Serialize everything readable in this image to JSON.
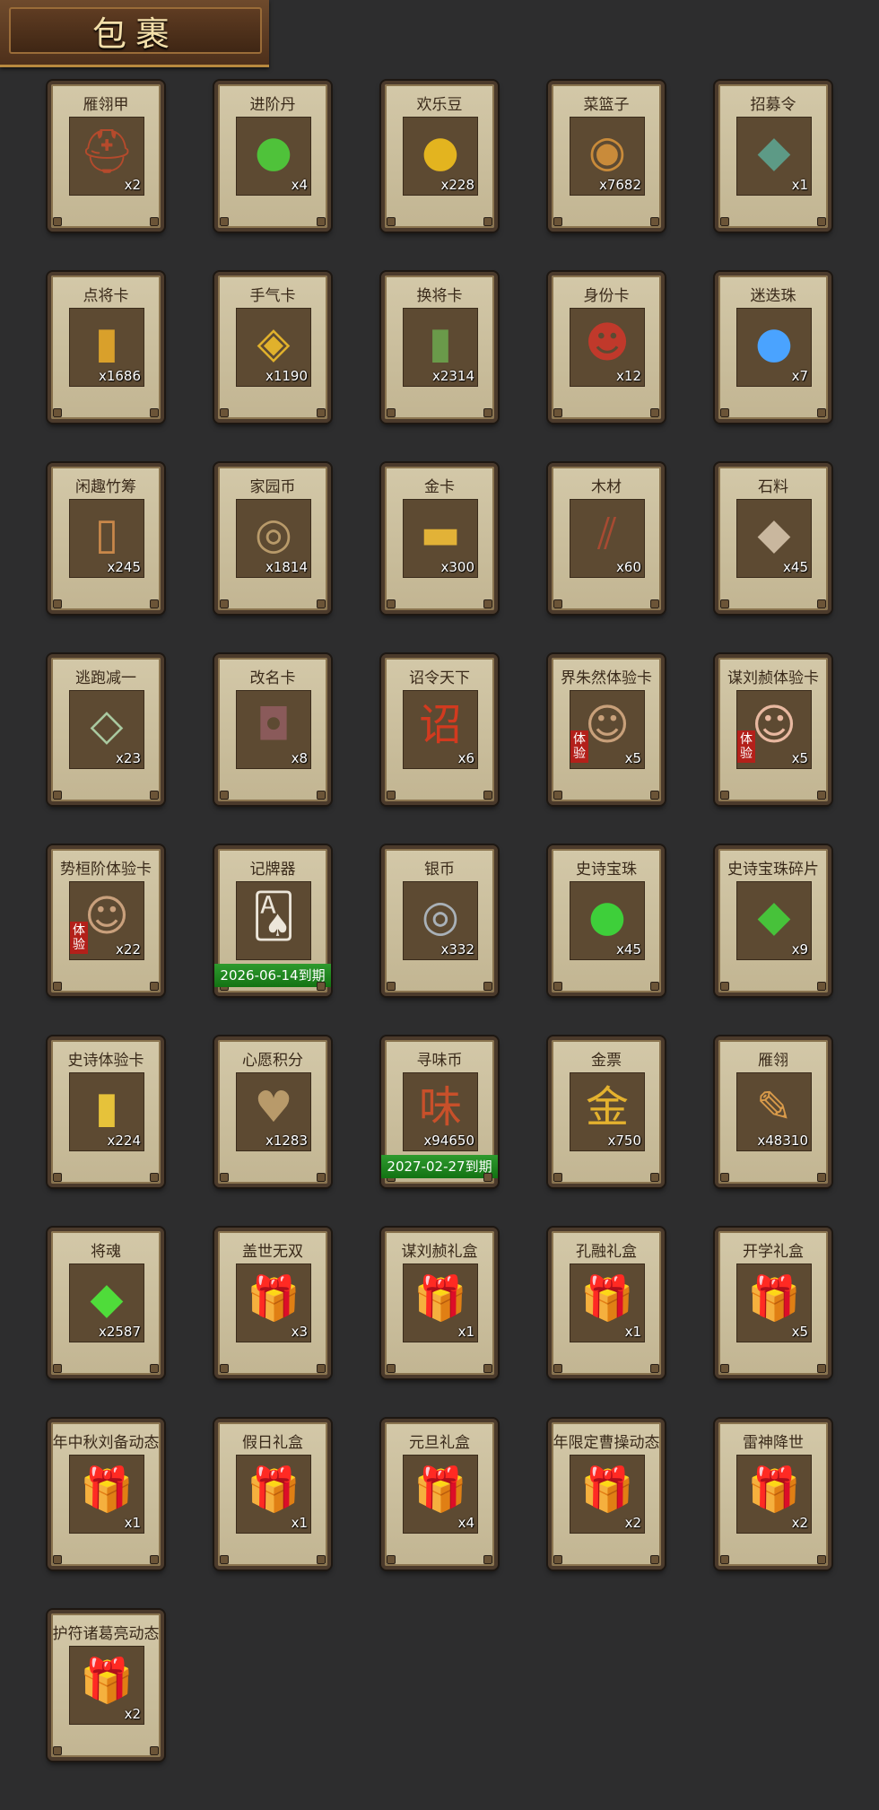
{
  "header": {
    "title": "包裹"
  },
  "items": [
    {
      "name": "雁翎甲",
      "count": "x2",
      "icon": "helmet-icon",
      "glyph": "⛑",
      "color": "#b54a2c"
    },
    {
      "name": "进阶丹",
      "count": "x4",
      "icon": "green-pill-icon",
      "glyph": "●",
      "color": "#4fc23a"
    },
    {
      "name": "欢乐豆",
      "count": "x228",
      "icon": "gold-beans-icon",
      "glyph": "●",
      "color": "#e3b41f"
    },
    {
      "name": "菜篮子",
      "count": "x7682",
      "icon": "basket-icon",
      "glyph": "◉",
      "color": "#c98b3a"
    },
    {
      "name": "招募令",
      "count": "x1",
      "icon": "recruit-token-icon",
      "glyph": "◆",
      "color": "#5d9a86"
    },
    {
      "name": "点将卡",
      "count": "x1686",
      "icon": "general-card-icon",
      "glyph": "▮",
      "color": "#d9a02b"
    },
    {
      "name": "手气卡",
      "count": "x1190",
      "icon": "luck-card-icon",
      "glyph": "◈",
      "color": "#e0b12c"
    },
    {
      "name": "换将卡",
      "count": "x2314",
      "icon": "swap-card-icon",
      "glyph": "▮",
      "color": "#6a9a4a"
    },
    {
      "name": "身份卡",
      "count": "x12",
      "icon": "identity-card-icon",
      "glyph": "☻",
      "color": "#c0392b"
    },
    {
      "name": "迷迭珠",
      "count": "x7",
      "icon": "blue-orb-icon",
      "glyph": "●",
      "color": "#4aa3ff"
    },
    {
      "name": "闲趣竹筹",
      "count": "x245",
      "icon": "bamboo-tally-icon",
      "glyph": "▯",
      "color": "#c9884a"
    },
    {
      "name": "家园币",
      "count": "x1814",
      "icon": "home-coin-icon",
      "glyph": "◎",
      "color": "#b89a6a"
    },
    {
      "name": "金卡",
      "count": "x300",
      "icon": "gold-card-icon",
      "glyph": "▬",
      "color": "#e2b237"
    },
    {
      "name": "木材",
      "count": "x60",
      "icon": "wood-icon",
      "glyph": "⫽",
      "color": "#a84a32"
    },
    {
      "name": "石料",
      "count": "x45",
      "icon": "stone-icon",
      "glyph": "◆",
      "color": "#c9b79e"
    },
    {
      "name": "逃跑减一",
      "count": "x23",
      "icon": "jade-token-icon",
      "glyph": "◇",
      "color": "#a9c9a0"
    },
    {
      "name": "改名卡",
      "count": "x8",
      "icon": "rename-tag-icon",
      "glyph": "◘",
      "color": "#8a5a5a"
    },
    {
      "name": "诏令天下",
      "count": "x6",
      "icon": "decree-scroll-icon",
      "glyph": "诏",
      "color": "#d23a1f"
    },
    {
      "name": "界朱然体验卡",
      "count": "x5",
      "icon": "portrait-zhuran-icon",
      "glyph": "☺",
      "color": "#c8a07a",
      "trial": "体验"
    },
    {
      "name": "谋刘赪体验卡",
      "count": "x5",
      "icon": "portrait-liucheng-icon",
      "glyph": "☺",
      "color": "#e8b8a0",
      "trial": "体验"
    },
    {
      "name": "势桓阶体验卡",
      "count": "x22",
      "icon": "portrait-huanjie-icon",
      "glyph": "☺",
      "color": "#c9a07c",
      "trial": "体验"
    },
    {
      "name": "记牌器",
      "count": "",
      "icon": "playing-cards-icon",
      "glyph": "🂡",
      "color": "#ece6da",
      "expiry": "2026-06-14到期"
    },
    {
      "name": "银币",
      "count": "x332",
      "icon": "silver-coin-icon",
      "glyph": "◎",
      "color": "#a9b1b8"
    },
    {
      "name": "史诗宝珠",
      "count": "x45",
      "icon": "epic-orb-icon",
      "glyph": "●",
      "color": "#3ecf3a"
    },
    {
      "name": "史诗宝珠碎片",
      "count": "x9",
      "icon": "orb-fragment-icon",
      "glyph": "◆",
      "color": "#47c23a"
    },
    {
      "name": "史诗体验卡",
      "count": "x224",
      "icon": "epic-trial-card-icon",
      "glyph": "▮",
      "color": "#e6c23a"
    },
    {
      "name": "心愿积分",
      "count": "x1283",
      "icon": "wish-coin-icon",
      "glyph": "♥",
      "color": "#b89a6a"
    },
    {
      "name": "寻味币",
      "count": "x94650",
      "icon": "flavor-coin-icon",
      "glyph": "味",
      "color": "#c8502a",
      "expiry": "2027-02-27到期"
    },
    {
      "name": "金票",
      "count": "x750",
      "icon": "gold-ticket-icon",
      "glyph": "金",
      "color": "#e4b22e"
    },
    {
      "name": "雁翎",
      "count": "x48310",
      "icon": "feather-icon",
      "glyph": "✎",
      "color": "#d89a4a"
    },
    {
      "name": "将魂",
      "count": "x2587",
      "icon": "general-soul-icon",
      "glyph": "◆",
      "color": "#4fdc3a"
    },
    {
      "name": "盖世无双",
      "count": "x3",
      "icon": "red-gift-box-icon",
      "glyph": "🎁",
      "color": "#c63a2a"
    },
    {
      "name": "谋刘赪礼盒",
      "count": "x1",
      "icon": "blue-gift-box-icon",
      "glyph": "🎁",
      "color": "#2a66d6"
    },
    {
      "name": "孔融礼盒",
      "count": "x1",
      "icon": "blue-gift-box-icon",
      "glyph": "🎁",
      "color": "#2a66d6"
    },
    {
      "name": "开学礼盒",
      "count": "x5",
      "icon": "purple-gift-box-icon",
      "glyph": "🎁",
      "color": "#9a3a7a"
    },
    {
      "name": "年中秋刘备动态",
      "count": "x1",
      "icon": "orange-gift-box-icon",
      "glyph": "🎁",
      "color": "#e08a2a"
    },
    {
      "name": "假日礼盒",
      "count": "x1",
      "icon": "red-gift-box-icon",
      "glyph": "🎁",
      "color": "#c63a2a"
    },
    {
      "name": "元旦礼盒",
      "count": "x4",
      "icon": "blue-gift-box-icon",
      "glyph": "🎁",
      "color": "#3a6aa8"
    },
    {
      "name": "年限定曹操动态",
      "count": "x2",
      "icon": "orange-gift-box-icon",
      "glyph": "🎁",
      "color": "#e08a2a"
    },
    {
      "name": "雷神降世",
      "count": "x2",
      "icon": "gold-gift-box-icon",
      "glyph": "🎁",
      "color": "#d6b25a"
    },
    {
      "name": "护符诸葛亮动态",
      "count": "x2",
      "icon": "orange-gift-box-icon",
      "glyph": "🎁",
      "color": "#e08a2a"
    }
  ]
}
